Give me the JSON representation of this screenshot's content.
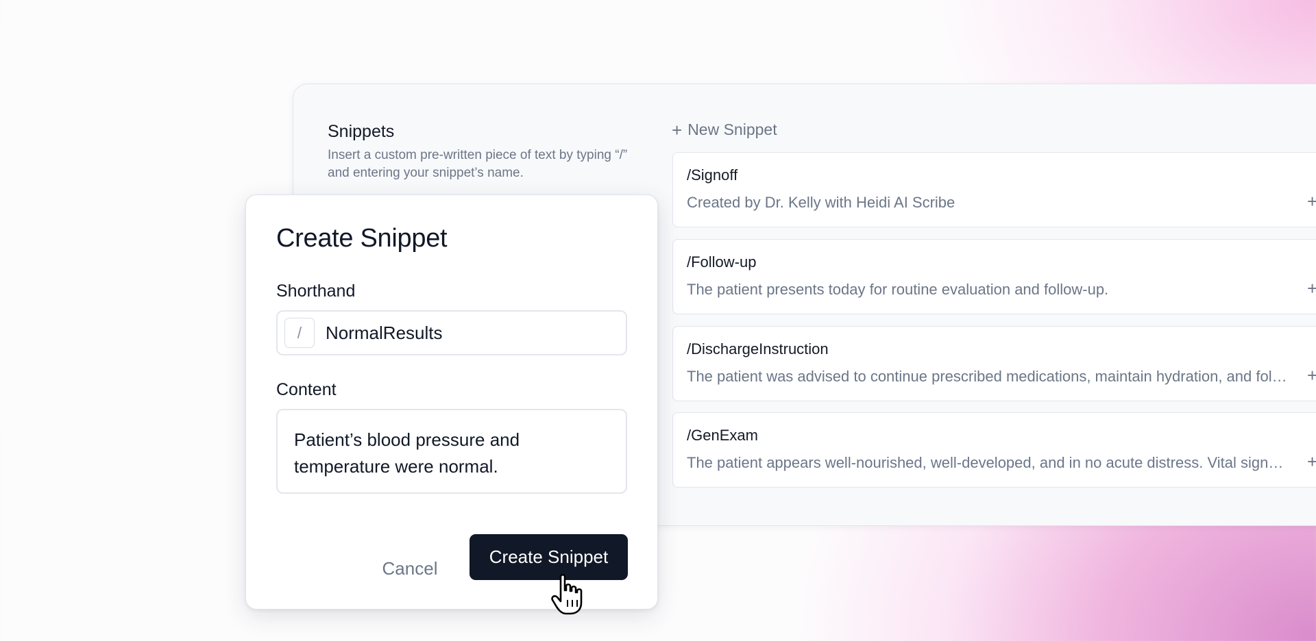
{
  "settings": {
    "title": "Snippets",
    "description": "Insert a custom pre-written piece of text by typing “/” and entering your snippet’s name.",
    "new_snippet_label": "New Snippet"
  },
  "snippets": [
    {
      "name": "/Signoff",
      "content": "Created by Dr. Kelly with Heidi AI Scribe"
    },
    {
      "name": "/Follow-up",
      "content": "The patient presents today for routine evaluation and follow-up."
    },
    {
      "name": "/DischargeInstruction",
      "content": "The patient was advised to continue prescribed medications, maintain hydration, and follow up as instructed."
    },
    {
      "name": "/GenExam",
      "content": "The patient appears well-nourished, well-developed, and in no acute distress. Vital signs are within normal limits."
    }
  ],
  "modal": {
    "title": "Create Snippet",
    "shorthand_label": "Shorthand",
    "slash": "/",
    "shorthand_value": "NormalResults",
    "content_label": "Content",
    "content_value": "Patient’s blood pressure and temperature were normal.",
    "cancel_label": "Cancel",
    "create_label": "Create Snippet"
  },
  "icons": {
    "plus": "plus-icon",
    "cursor": "hand-pointer-icon"
  }
}
